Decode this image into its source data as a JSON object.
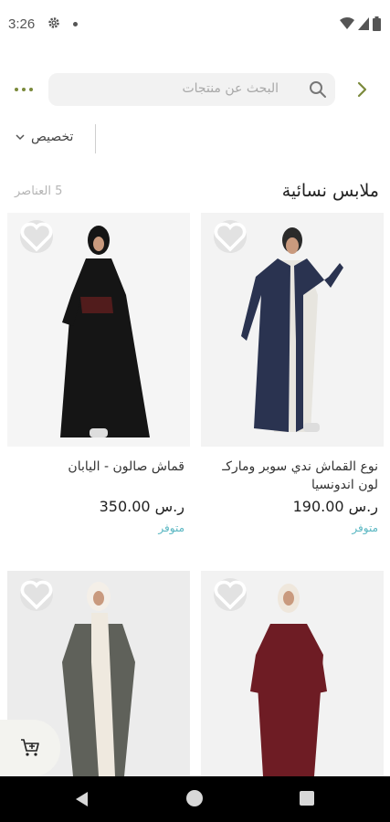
{
  "status_bar": {
    "time": "3:26"
  },
  "search": {
    "placeholder": "البحث عن منتجات"
  },
  "filter": {
    "label": "تخصيص"
  },
  "section": {
    "title": "ملابس نسائية",
    "count": "5 العناصر"
  },
  "products": [
    {
      "name": "نوع القماش ندي سوبر وماركـ لون اندونسيا",
      "price": "ر.س 190.00",
      "stock": "متوفر",
      "garment_color": "#2a3350"
    },
    {
      "name": "قماش صالون - اليابان",
      "price": "ر.س 350.00",
      "stock": "متوفر",
      "garment_color": "#151515"
    },
    {
      "name": "",
      "price": "",
      "stock": "",
      "garment_color": "#6e1c24"
    },
    {
      "name": "",
      "price": "",
      "stock": "",
      "garment_color": "#5f615a"
    }
  ],
  "colors": {
    "accent": "#7b8a3c",
    "stock": "#5ab7c2"
  }
}
